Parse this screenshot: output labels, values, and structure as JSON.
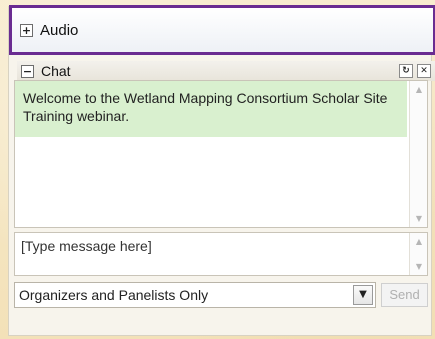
{
  "audio": {
    "toggle_glyph": "+",
    "label": "Audio"
  },
  "chat": {
    "toggle_glyph": "−",
    "label": "Chat",
    "popout_glyph": "↻",
    "close_glyph": "✕",
    "messages": [
      {
        "text": "Welcome to the Wetland Mapping Consortium Scholar Site Training webinar."
      }
    ],
    "scroll_up_glyph": "▲",
    "scroll_down_glyph": "▼"
  },
  "input": {
    "placeholder": "[Type message here]"
  },
  "footer": {
    "recipient": "Organizers and Panelists Only",
    "dropdown_glyph": "▼",
    "send_label": "Send"
  },
  "colors": {
    "highlight_border": "#6a2c91",
    "message_bg": "#d9f0cf",
    "page_bg": "#f6e9c8"
  },
  "icons": [
    "plus-icon",
    "minus-icon",
    "popout-icon",
    "close-icon",
    "chevron-down-icon"
  ]
}
